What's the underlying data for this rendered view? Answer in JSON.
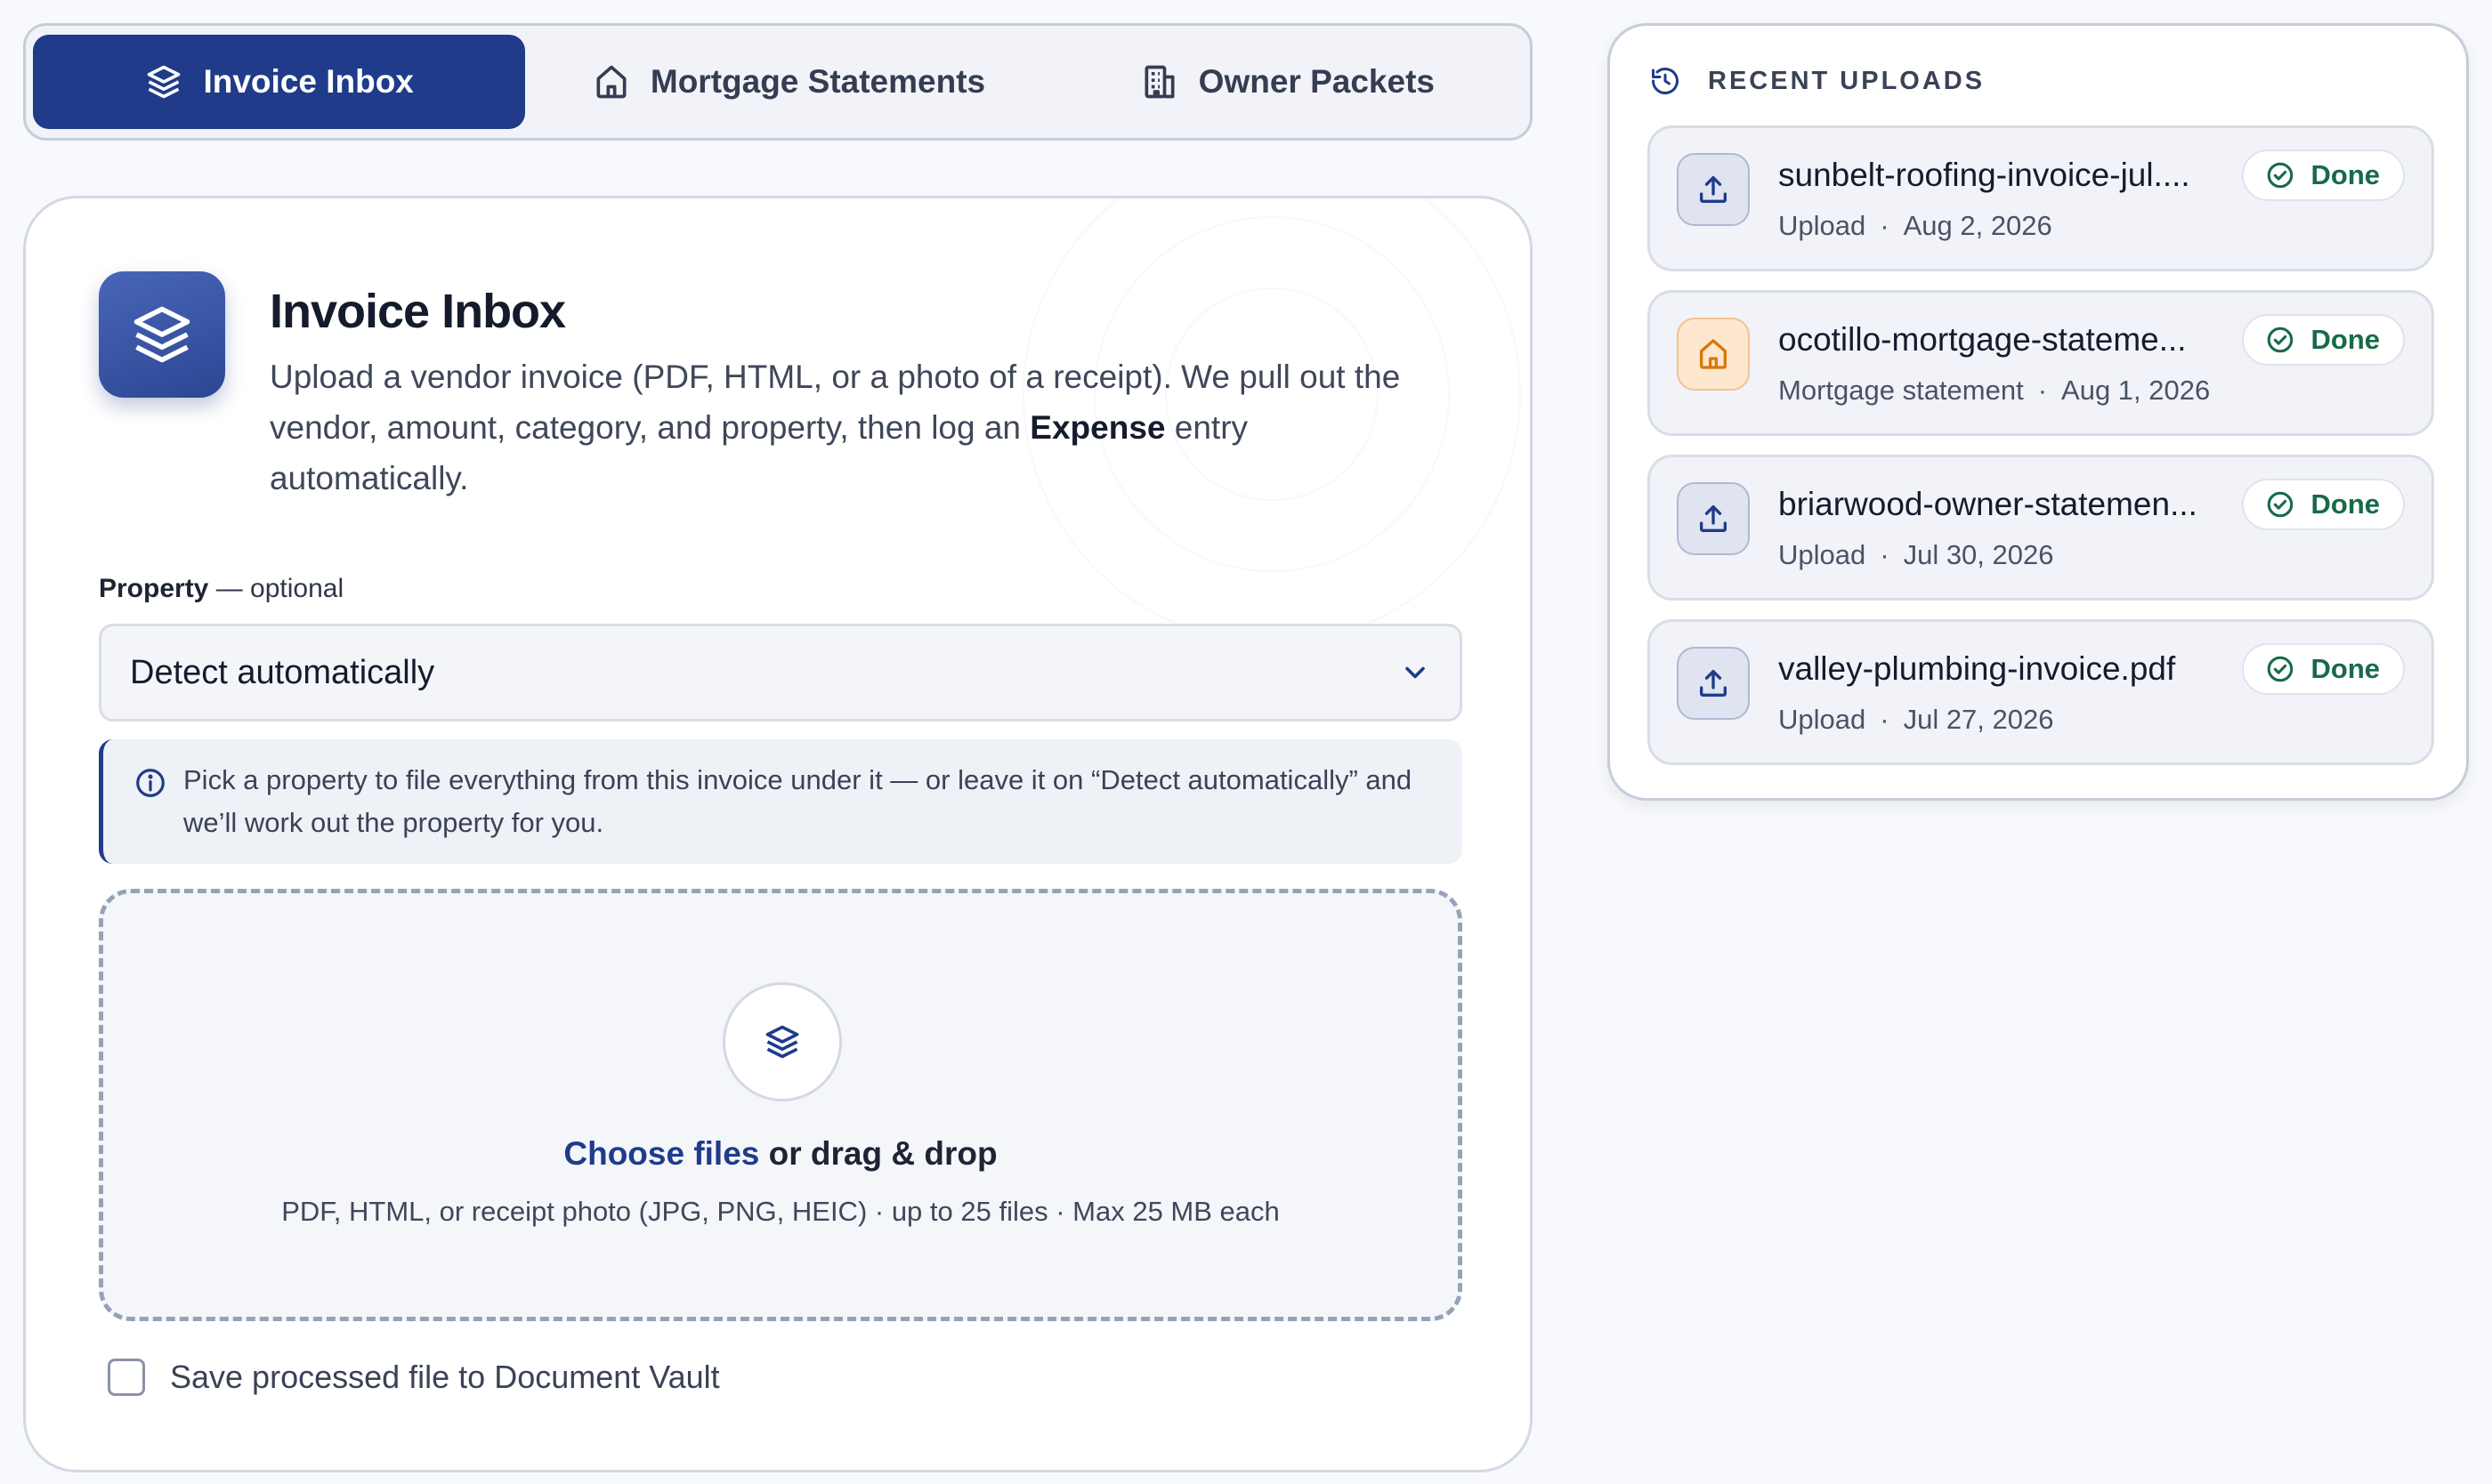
{
  "tabs": [
    {
      "label": "Invoice Inbox",
      "icon": "layers-icon",
      "active": true
    },
    {
      "label": "Mortgage Statements",
      "icon": "home-icon",
      "active": false
    },
    {
      "label": "Owner Packets",
      "icon": "building-icon",
      "active": false
    }
  ],
  "card": {
    "title": "Invoice Inbox",
    "description_before": "Upload a vendor invoice (PDF, HTML, or a photo of a receipt). We pull out the vendor, amount, category, and property, then log an ",
    "description_bold": "Expense",
    "description_after": " entry automatically.",
    "property_label": "Property",
    "property_label_suffix": " — optional",
    "property_select_value": "Detect automatically",
    "info_text": "Pick a property to file everything from this invoice under it — or leave it on “Detect automatically” and we’ll work out the property for you.",
    "dropzone": {
      "choose_files": "Choose files",
      "or_drag": " or drag & drop",
      "hint": "PDF, HTML, or receipt photo (JPG, PNG, HEIC) · up to 25 files · Max 25 MB each"
    },
    "save_checkbox_label": "Save processed file to Document Vault",
    "save_checked": false
  },
  "recent": {
    "title": "RECENT UPLOADS",
    "items": [
      {
        "name": "sunbelt-roofing-invoice-jul....",
        "type": "Upload",
        "date": "Aug 2, 2026",
        "status": "Done",
        "icon": "upload-icon"
      },
      {
        "name": "ocotillo-mortgage-stateme...",
        "type": "Mortgage statement",
        "date": "Aug 1, 2026",
        "status": "Done",
        "icon": "home-icon"
      },
      {
        "name": "briarwood-owner-statemen...",
        "type": "Upload",
        "date": "Jul 30, 2026",
        "status": "Done",
        "icon": "upload-icon"
      },
      {
        "name": "valley-plumbing-invoice.pdf",
        "type": "Upload",
        "date": "Jul 27, 2026",
        "status": "Done",
        "icon": "upload-icon"
      }
    ]
  },
  "colors": {
    "accent": "#1f3b8a",
    "success": "#176b48",
    "mortgage_icon": "#d97706"
  }
}
